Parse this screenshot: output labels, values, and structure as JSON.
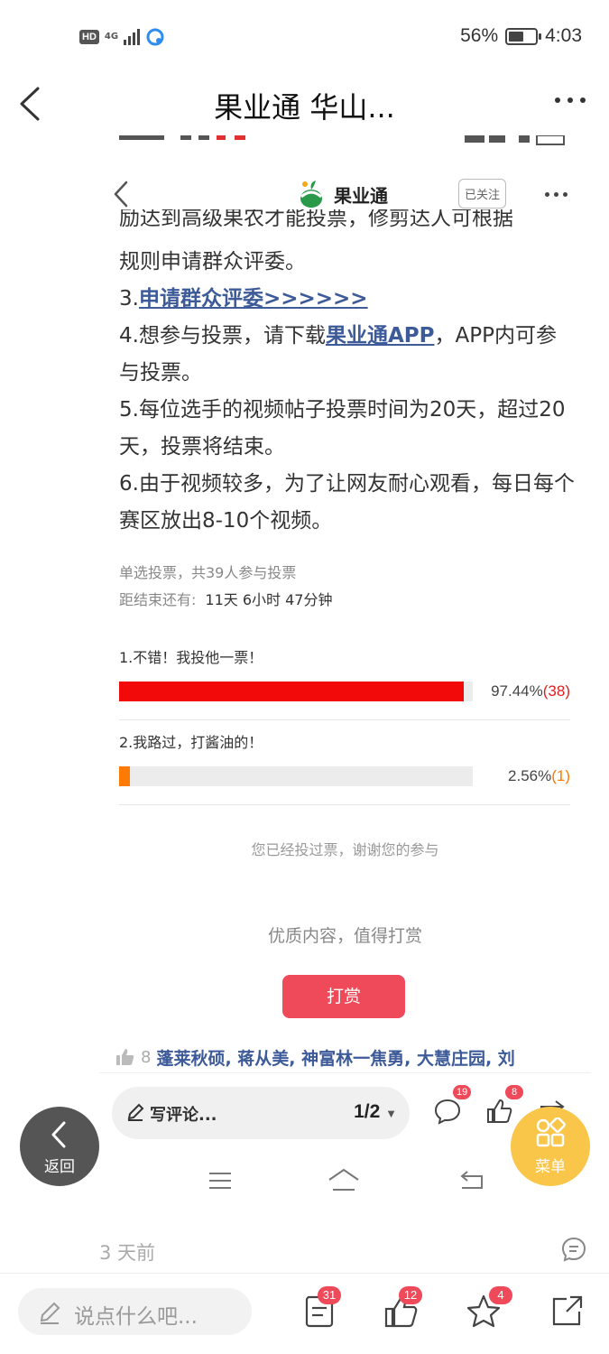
{
  "status_bar": {
    "hd": "HD",
    "network": "4G",
    "battery_percent": "56%",
    "battery_level": 0.56,
    "time": "4:03"
  },
  "outer_nav": {
    "title": "果业通 华山..."
  },
  "inner": {
    "brand_name": "果业通",
    "follow_label": "已关注",
    "article": {
      "cut_line": "励达到高级果农才能投票，修剪达人可根据",
      "line_rule": "规则申请群众评委。",
      "item3_prefix": "3.",
      "item3_link": "申请群众评委>>>>>>",
      "item4_prefix": "4.想参与投票，请下载",
      "item4_link": "果业通APP",
      "item4_suffix": "，APP内可参与投票。",
      "item5": "5.每位选手的视频帖子投票时间为20天，超过20天，投票将结束。",
      "item6": "6.由于视频较多，为了让网友耐心观看，每日每个赛区放出8-10个视频。"
    },
    "poll": {
      "meta": "单选投票，共39人参与投票",
      "countdown_label": "距结束还有:",
      "countdown_value": "11天 6小时 47分钟",
      "options": [
        {
          "label": "1.不错！我投他一票！",
          "percent": "97.44%",
          "count": "(38)",
          "fraction": 0.9744,
          "color": "#f20a0a"
        },
        {
          "label": "2.我路过，打酱油的！",
          "percent": "2.56%",
          "count": "(1)",
          "fraction": 0.0256,
          "color": "#ff7a00"
        }
      ],
      "voted_text": "您已经投过票，谢谢您的参与"
    },
    "reward": {
      "text": "优质内容，值得打赏",
      "button": "打赏"
    },
    "likers": {
      "count": "8",
      "names": "蓬莱秋硕, 蒋从美, 神富林一焦勇, 大慧庄园, 刘"
    },
    "toolbar": {
      "comment_placeholder": "写评论...",
      "page": "1/2",
      "comment_badge": "19",
      "like_badge": "8"
    }
  },
  "floating": {
    "back_label": "返回",
    "menu_label": "菜单"
  },
  "bottom": {
    "time_ago": "3 天前",
    "input_placeholder": "说点什么吧...",
    "notes_badge": "31",
    "like_badge": "12",
    "star_badge": "4"
  }
}
